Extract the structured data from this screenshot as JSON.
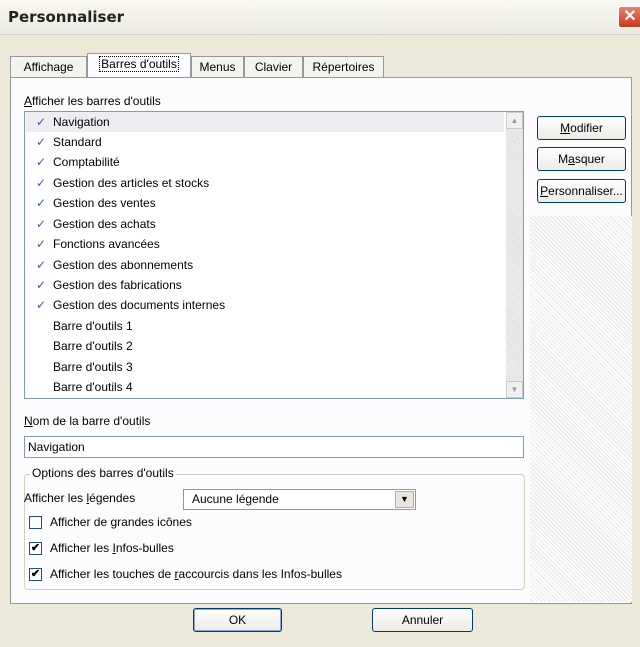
{
  "window": {
    "title": "Personnaliser",
    "close_glyph": "✕"
  },
  "tabs": [
    {
      "label": "Affichage"
    },
    {
      "label": "Barres d'outils"
    },
    {
      "label": "Menus"
    },
    {
      "label": "Clavier"
    },
    {
      "label": "Répertoires"
    }
  ],
  "toolbars_section": {
    "label_first": "A",
    "label_rest": "fficher les barres d'outils",
    "items": [
      {
        "label": "Navigation",
        "checked": true
      },
      {
        "label": "Standard",
        "checked": true
      },
      {
        "label": "Comptabilité",
        "checked": true
      },
      {
        "label": "Gestion des articles et stocks",
        "checked": true
      },
      {
        "label": "Gestion des ventes",
        "checked": true
      },
      {
        "label": "Gestion des achats",
        "checked": true
      },
      {
        "label": "Fonctions avancées",
        "checked": true
      },
      {
        "label": "Gestion des abonnements",
        "checked": true
      },
      {
        "label": "Gestion des fabrications",
        "checked": true
      },
      {
        "label": "Gestion des documents internes",
        "checked": true
      },
      {
        "label": "Barre d'outils 1",
        "checked": false
      },
      {
        "label": "Barre d'outils 2",
        "checked": false
      },
      {
        "label": "Barre d'outils 3",
        "checked": false
      },
      {
        "label": "Barre d'outils 4",
        "checked": false
      }
    ],
    "check_glyph": "✓"
  },
  "side_buttons": {
    "modify_first": "M",
    "modify_rest": "odifier",
    "hide_pre": "M",
    "hide_u": "a",
    "hide_post": "squer",
    "customize_first": "P",
    "customize_rest": "ersonnaliser..."
  },
  "name_field": {
    "label_first": "N",
    "label_rest": "om de la barre d'outils",
    "value": "Navigation"
  },
  "options": {
    "legend": "Options des barres d'outils",
    "captions_pre": "Afficher les ",
    "captions_u": "l",
    "captions_post": "égendes",
    "captions_value": "Aucune légende",
    "large_icons": {
      "label": "Afficher de grandes icônes",
      "checked": false
    },
    "tooltips": {
      "pre": "Afficher les ",
      "u": "I",
      "post": "nfos-bulles",
      "checked": true
    },
    "shortcuts": {
      "pre": "Afficher les touches de ",
      "u": "r",
      "post": "accourcis dans les Infos-bulles",
      "checked": true
    },
    "check_glyph": "✔"
  },
  "footer": {
    "ok": "OK",
    "cancel": "Annuler"
  }
}
